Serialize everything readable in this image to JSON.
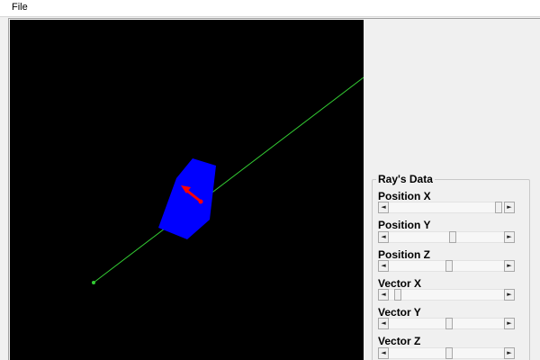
{
  "menu": {
    "file_label": "File"
  },
  "viewport": {
    "background": "#000000",
    "ray_color": "#33cc33",
    "box_color": "#0000ff",
    "arrow_color": "#ff0000"
  },
  "panel": {
    "group_title": "Ray's Data",
    "sliders": [
      {
        "label": "Position X",
        "value": 0.97
      },
      {
        "label": "Position Y",
        "value": 0.55
      },
      {
        "label": "Position Z",
        "value": 0.52
      },
      {
        "label": "Vector X",
        "value": 0.05
      },
      {
        "label": "Vector Y",
        "value": 0.52
      },
      {
        "label": "Vector Z",
        "value": 0.52
      }
    ]
  },
  "icons": {
    "scroll_left": "◄",
    "scroll_right": "►"
  }
}
